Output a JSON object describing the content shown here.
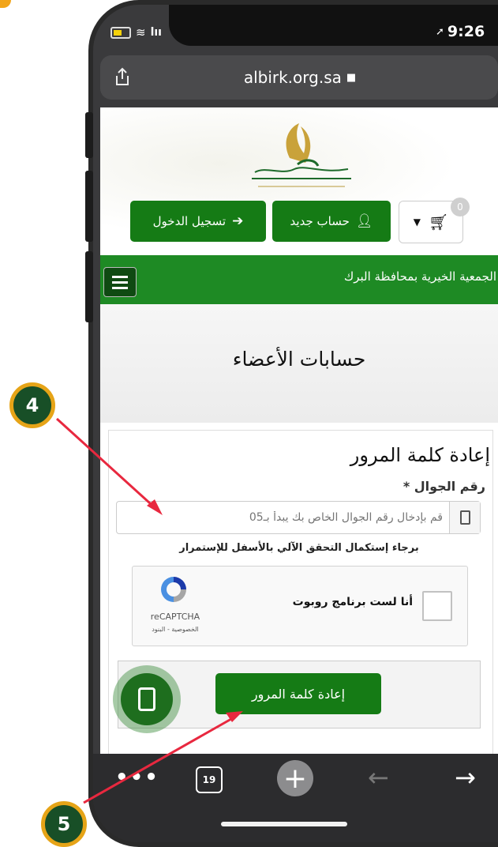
{
  "status_bar": {
    "time": "9:26"
  },
  "browser": {
    "url": "albirk.org.sa",
    "tab_count": "19"
  },
  "site": {
    "cart_count": "0",
    "new_account_label": "حساب جديد",
    "login_label": "تسجيل الدخول",
    "nav_title": "الجمعية الخيرية بمحافظة البرك",
    "page_heading": "حسابات الأعضاء"
  },
  "form": {
    "title": "إعادة كلمة المرور",
    "phone_label": "رقم الجوال *",
    "phone_placeholder": "قم بإدخال رقم الجوال الخاص بك يبدأ بـ05",
    "captcha_instruction": "برجاء إستكمال التحقق الآلي بالأسفل للإستمرار",
    "captcha_checkbox_label": "أنا لست برنامج روبوت",
    "captcha_brand": "reCAPTCHA",
    "captcha_links": "الخصوصية - البنود",
    "submit_label": "إعادة كلمة المرور"
  },
  "annotations": {
    "step_a": "4",
    "step_b": "5"
  },
  "colors": {
    "brand_green": "#157b15",
    "badge_fill": "#184f27",
    "badge_border": "#e6a417",
    "arrow": "#e8283f"
  }
}
